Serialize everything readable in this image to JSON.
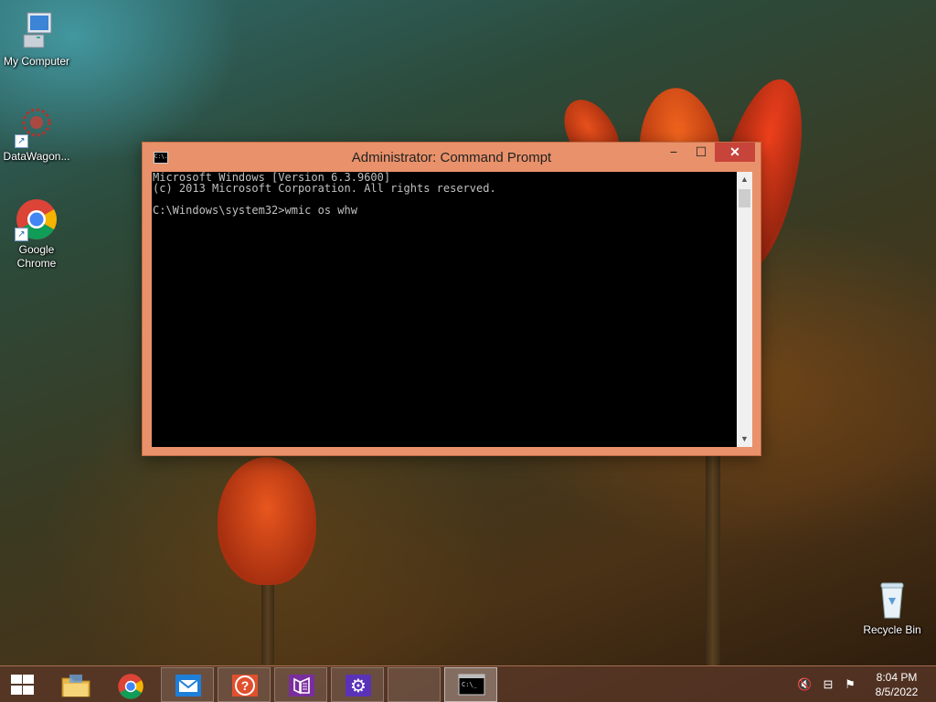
{
  "desktop": {
    "icons": [
      {
        "label": "My Computer"
      },
      {
        "label": "DataWagon..."
      },
      {
        "label": "Google Chrome"
      },
      {
        "label": "Recycle Bin"
      }
    ]
  },
  "window": {
    "title": "Administrator: Command Prompt",
    "title_icon_text": "C:\\.",
    "minimize_glyph": "−",
    "maximize_glyph": "☐",
    "close_glyph": "✕",
    "console_lines": [
      "Microsoft Windows [Version 6.3.9600]",
      "(c) 2013 Microsoft Corporation. All rights reserved.",
      "",
      "C:\\Windows\\system32>wmic os whw"
    ],
    "scroll_up_glyph": "▲",
    "scroll_down_glyph": "▼"
  },
  "taskbar": {
    "items": [
      {
        "icon": "file-explorer-icon"
      },
      {
        "icon": "chrome-icon"
      },
      {
        "icon": "mail-icon"
      },
      {
        "icon": "help-icon"
      },
      {
        "icon": "visual-studio-icon"
      },
      {
        "icon": "settings-icon"
      },
      {
        "icon": "empty-app-icon"
      },
      {
        "icon": "command-prompt-icon"
      }
    ],
    "cmd_icon_text": "C:\\_",
    "help_glyph": "?",
    "settings_glyph": "⚙",
    "tray": {
      "volume_glyph": "🔇",
      "network_glyph": "⊟",
      "flag_glyph": "⚑",
      "time": "8:04 PM",
      "date": "8/5/2022"
    }
  },
  "colors": {
    "window_frame": "#e9916a",
    "close_button": "#c7443a",
    "console_bg": "#000000",
    "console_text": "#c0c0c0"
  }
}
